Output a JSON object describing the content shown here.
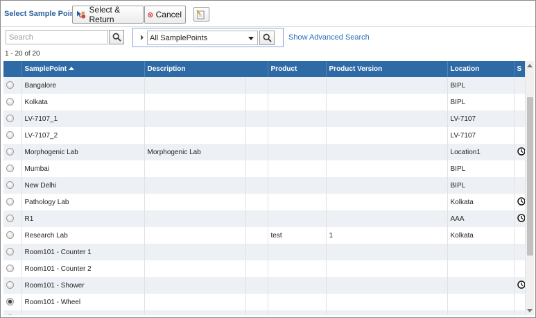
{
  "toolbar": {
    "title": "Select Sample Point",
    "select_return_label": "Select & Return",
    "cancel_label": "Cancel"
  },
  "search": {
    "placeholder": "Search",
    "value": "",
    "filter_selected": "All SamplePoints",
    "advanced_link": "Show Advanced Search"
  },
  "pager": {
    "summary": "1 - 20 of 20"
  },
  "grid": {
    "columns": [
      "SamplePoint",
      "Description",
      "Product",
      "Product Version",
      "Location",
      "S"
    ],
    "sort_column": "SamplePoint",
    "sort_direction": "ascending",
    "rows": [
      {
        "selected": false,
        "samplepoint": "Bangalore",
        "description": "",
        "product": "",
        "version": "",
        "location": "BIPL",
        "status_icon": ""
      },
      {
        "selected": false,
        "samplepoint": "Kolkata",
        "description": "",
        "product": "",
        "version": "",
        "location": "BIPL",
        "status_icon": ""
      },
      {
        "selected": false,
        "samplepoint": "LV-7107_1",
        "description": "",
        "product": "",
        "version": "",
        "location": "LV-7107",
        "status_icon": ""
      },
      {
        "selected": false,
        "samplepoint": "LV-7107_2",
        "description": "",
        "product": "",
        "version": "",
        "location": "LV-7107",
        "status_icon": ""
      },
      {
        "selected": false,
        "samplepoint": "Morphogenic Lab",
        "description": "Morphogenic Lab",
        "product": "",
        "version": "",
        "location": "Location1",
        "status_icon": "clock-icon"
      },
      {
        "selected": false,
        "samplepoint": "Mumbai",
        "description": "",
        "product": "",
        "version": "",
        "location": "BIPL",
        "status_icon": ""
      },
      {
        "selected": false,
        "samplepoint": "New Delhi",
        "description": "",
        "product": "",
        "version": "",
        "location": "BIPL",
        "status_icon": ""
      },
      {
        "selected": false,
        "samplepoint": "Pathology Lab",
        "description": "",
        "product": "",
        "version": "",
        "location": "Kolkata",
        "status_icon": "clock-icon"
      },
      {
        "selected": false,
        "samplepoint": "R1",
        "description": "",
        "product": "",
        "version": "",
        "location": "AAA",
        "status_icon": "clock-icon"
      },
      {
        "selected": false,
        "samplepoint": "Research Lab",
        "description": "",
        "product": "test",
        "version": "1",
        "location": "Kolkata",
        "status_icon": ""
      },
      {
        "selected": false,
        "samplepoint": "Room101 - Counter 1",
        "description": "",
        "product": "",
        "version": "",
        "location": "",
        "status_icon": ""
      },
      {
        "selected": false,
        "samplepoint": "Room101 - Counter 2",
        "description": "",
        "product": "",
        "version": "",
        "location": "",
        "status_icon": ""
      },
      {
        "selected": false,
        "samplepoint": "Room101 - Shower",
        "description": "",
        "product": "",
        "version": "",
        "location": "",
        "status_icon": "clock-icon"
      },
      {
        "selected": true,
        "samplepoint": "Room101 - Wheel",
        "description": "",
        "product": "",
        "version": "",
        "location": "",
        "status_icon": ""
      },
      {
        "selected": false,
        "samplepoint": "",
        "description": "",
        "product": "",
        "version": "",
        "location": "",
        "status_icon": ""
      }
    ]
  },
  "colors": {
    "header_bg": "#2e6aa5",
    "title_text": "#2a5f9e",
    "link": "#2a6fb8",
    "row_alt": "#edf1f5",
    "cancel_red": "#d42020"
  }
}
